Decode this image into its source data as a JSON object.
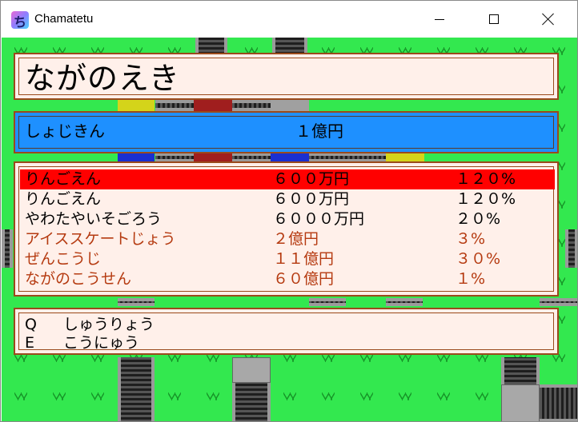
{
  "window": {
    "title": "Chamatetu",
    "icon": "app-icon",
    "controls": [
      "minimize-icon",
      "maximize-icon",
      "close-icon"
    ]
  },
  "station": {
    "name": "ながのえき"
  },
  "money": {
    "label": "しょじきん",
    "value": "１億円"
  },
  "properties": {
    "selected_index": 0,
    "selected_color": "#ff0000",
    "rows": [
      {
        "name": "りんごえん",
        "price": "６００万円",
        "rate": "１２０%",
        "color": "black"
      },
      {
        "name": "りんごえん",
        "price": "６００万円",
        "rate": "１２０%",
        "color": "black"
      },
      {
        "name": "やわたやいそごろう",
        "price": "６０００万円",
        "rate": "２０%",
        "color": "black"
      },
      {
        "name": "アイススケートじょう",
        "price": "２億円",
        "rate": "３%",
        "color": "brown"
      },
      {
        "name": "ぜんこうじ",
        "price": "１１億円",
        "rate": "３０%",
        "color": "brown"
      },
      {
        "name": "ながのこうせん",
        "price": "６０億円",
        "rate": "１%",
        "color": "brown"
      }
    ]
  },
  "commands": [
    {
      "key": "Q",
      "label": "しゅうりょう"
    },
    {
      "key": "E",
      "label": "こうにゅう"
    }
  ],
  "colors": {
    "grass": "#33e84f",
    "panel_bg": "#fff0ea",
    "panel_border": "#9a4a1c",
    "money_bg": "#1e90ff",
    "text_brown": "#b53a10"
  }
}
